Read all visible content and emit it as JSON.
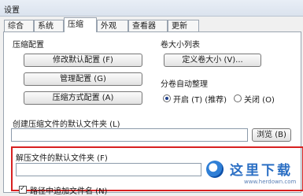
{
  "window": {
    "title": "设置"
  },
  "tabs": [
    {
      "label": "综合"
    },
    {
      "label": "系统"
    },
    {
      "label": "压缩",
      "active": true
    },
    {
      "label": "外观"
    },
    {
      "label": "查看器"
    },
    {
      "label": "更新"
    }
  ],
  "compression_config": {
    "heading": "压缩配置",
    "buttons": [
      {
        "label": "修改默认配置 (F)"
      },
      {
        "label": "管理配置 (G)"
      },
      {
        "label": "压缩方式配置 (A)"
      }
    ]
  },
  "volume_size_list": {
    "heading": "卷大小列表",
    "button": "定义卷大小 (V)..."
  },
  "volume_auto_arrange": {
    "heading": "分卷自动整理",
    "options": [
      {
        "label": "开启 (T) (推荐)",
        "checked": true
      },
      {
        "label": "关闭 (O)",
        "checked": false
      }
    ]
  },
  "default_compress_folder": {
    "label": "创建压缩文件的默认文件夹 (L)",
    "value": "",
    "browse": "浏览 (B)"
  },
  "default_extract_folder": {
    "label": "解压文件的默认文件夹 (F)",
    "value": ""
  },
  "append_path_option": {
    "label": "路径中追加文件名 (N)",
    "checked": true
  },
  "watermark": {
    "text": "这里下载",
    "url": "www.herdown.com"
  },
  "colors": {
    "highlight": "#d72020",
    "accent": "#1e3e8a"
  }
}
